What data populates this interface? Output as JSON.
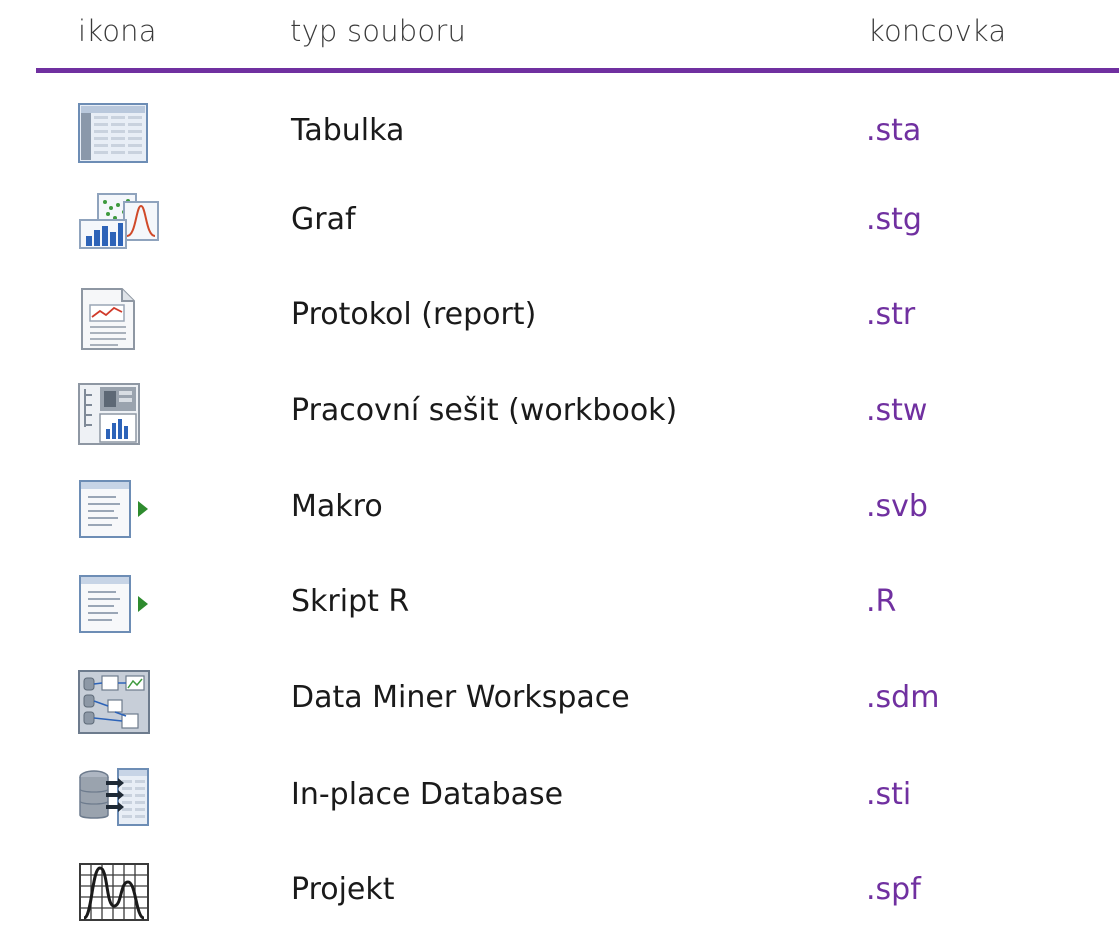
{
  "header": {
    "icon": "ikona",
    "type": "typ souboru",
    "ext": "koncovka"
  },
  "colors": {
    "accent": "#7030a0"
  },
  "rows": [
    {
      "icon": "spreadsheet-icon",
      "type": "Tabulka",
      "ext": ".sta"
    },
    {
      "icon": "graph-icon",
      "type": "Graf",
      "ext": ".stg"
    },
    {
      "icon": "report-icon",
      "type": "Protokol (report)",
      "ext": ".str"
    },
    {
      "icon": "workbook-icon",
      "type": "Pracovní sešit (workbook)",
      "ext": ".stw"
    },
    {
      "icon": "macro-icon",
      "type": "Makro",
      "ext": ".svb"
    },
    {
      "icon": "r-script-icon",
      "type": "Skript R",
      "ext": ".R"
    },
    {
      "icon": "data-miner-icon",
      "type": "Data Miner Workspace",
      "ext": ".sdm"
    },
    {
      "icon": "database-icon",
      "type": "In-place Database",
      "ext": ".sti"
    },
    {
      "icon": "project-icon",
      "type": "Projekt",
      "ext": ".spf"
    }
  ]
}
